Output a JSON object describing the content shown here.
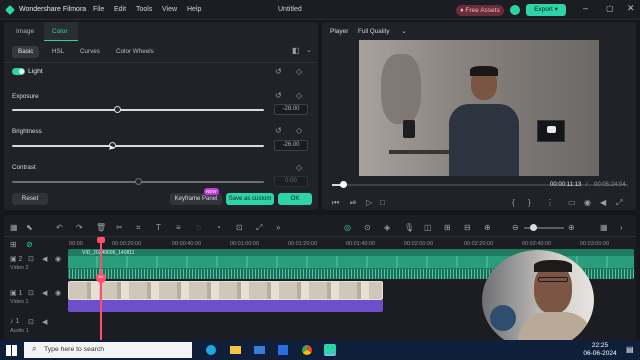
{
  "app": {
    "name": "Wondershare Filmora",
    "doc_title": "Untitled"
  },
  "menu": [
    "File",
    "Edit",
    "Tools",
    "View",
    "Help"
  ],
  "header": {
    "free_assets": "Free Assets",
    "export": "Export"
  },
  "panel": {
    "tabs": [
      "Image",
      "Color"
    ],
    "subtabs": [
      "Basic",
      "HSL",
      "Curves",
      "Color Wheels"
    ],
    "light_label": "Light",
    "exposure_label": "Exposure",
    "exposure_value": "-28.00",
    "exposure_level": 0.42,
    "brightness_label": "Brightness",
    "brightness_value": "-26.00",
    "brightness_level": 0.4,
    "contrast_label": "Contrast",
    "contrast_value": "0.00",
    "contrast_level": 0.5,
    "reset": "Reset",
    "keyframe": "Keyframe Panel",
    "new_badge": "NEW",
    "save_custom": "Save as custom",
    "ok": "OK"
  },
  "player": {
    "label": "Player",
    "quality": "Full Quality",
    "time_current": "00:00:11:13",
    "time_total": "00:05:24:04",
    "progress": 0.04
  },
  "timeline": {
    "ticks": [
      "00:00",
      "00:00:20:00",
      "00:00:40:00",
      "00:01:00:00",
      "00:01:20:00",
      "00:01:40:00",
      "00:02:00:00",
      "00:02:20:00",
      "00:02:40:00",
      "00:03:00:00"
    ],
    "video2": "Video 2",
    "video1": "Video 1",
    "audio1": "Audio 1",
    "clip_title": "VID_20240606_140811"
  },
  "taskbar": {
    "search_placeholder": "Type here to search",
    "time": "22:25",
    "date": "06-06-2024"
  },
  "colors": {
    "accent": "#2fd3a8",
    "video_clip": "#28a37f",
    "audio_clip": "#6c4fc9"
  }
}
